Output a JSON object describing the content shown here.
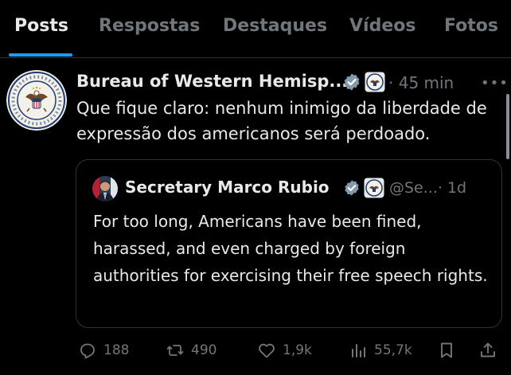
{
  "tabs": [
    {
      "label": "Posts",
      "active": true
    },
    {
      "label": "Respostas"
    },
    {
      "label": "Destaques"
    },
    {
      "label": "Vídeos"
    },
    {
      "label": "Fotos"
    }
  ],
  "post": {
    "author_name": "Bureau of Western Hemisp...",
    "time": "· 45 min",
    "text": "Que fique claro: nenhum inimigo da liberdade de expressão dos americanos será perdoado.",
    "avatar_icon": "department-of-state-seal-icon",
    "seal_lettering": "DEPARTMENT OF STATE · UNITED STATES OF AMERICA"
  },
  "quote": {
    "author_name": "Secretary Marco Rubio",
    "handle": "@Se...",
    "time": "· 1d",
    "text": "For too long, Americans have been fined, harassed, and even charged by foreign authorities for exercising their free speech rights."
  },
  "actions": {
    "replies": "188",
    "reposts": "490",
    "likes": "1,9k",
    "views": "55,7k"
  },
  "colors": {
    "background": "#000000",
    "text": "#e7e9ea",
    "muted": "#71767b",
    "accent": "#1d9bf0",
    "border": "#2f3336",
    "verified_gray": "#829aab"
  }
}
